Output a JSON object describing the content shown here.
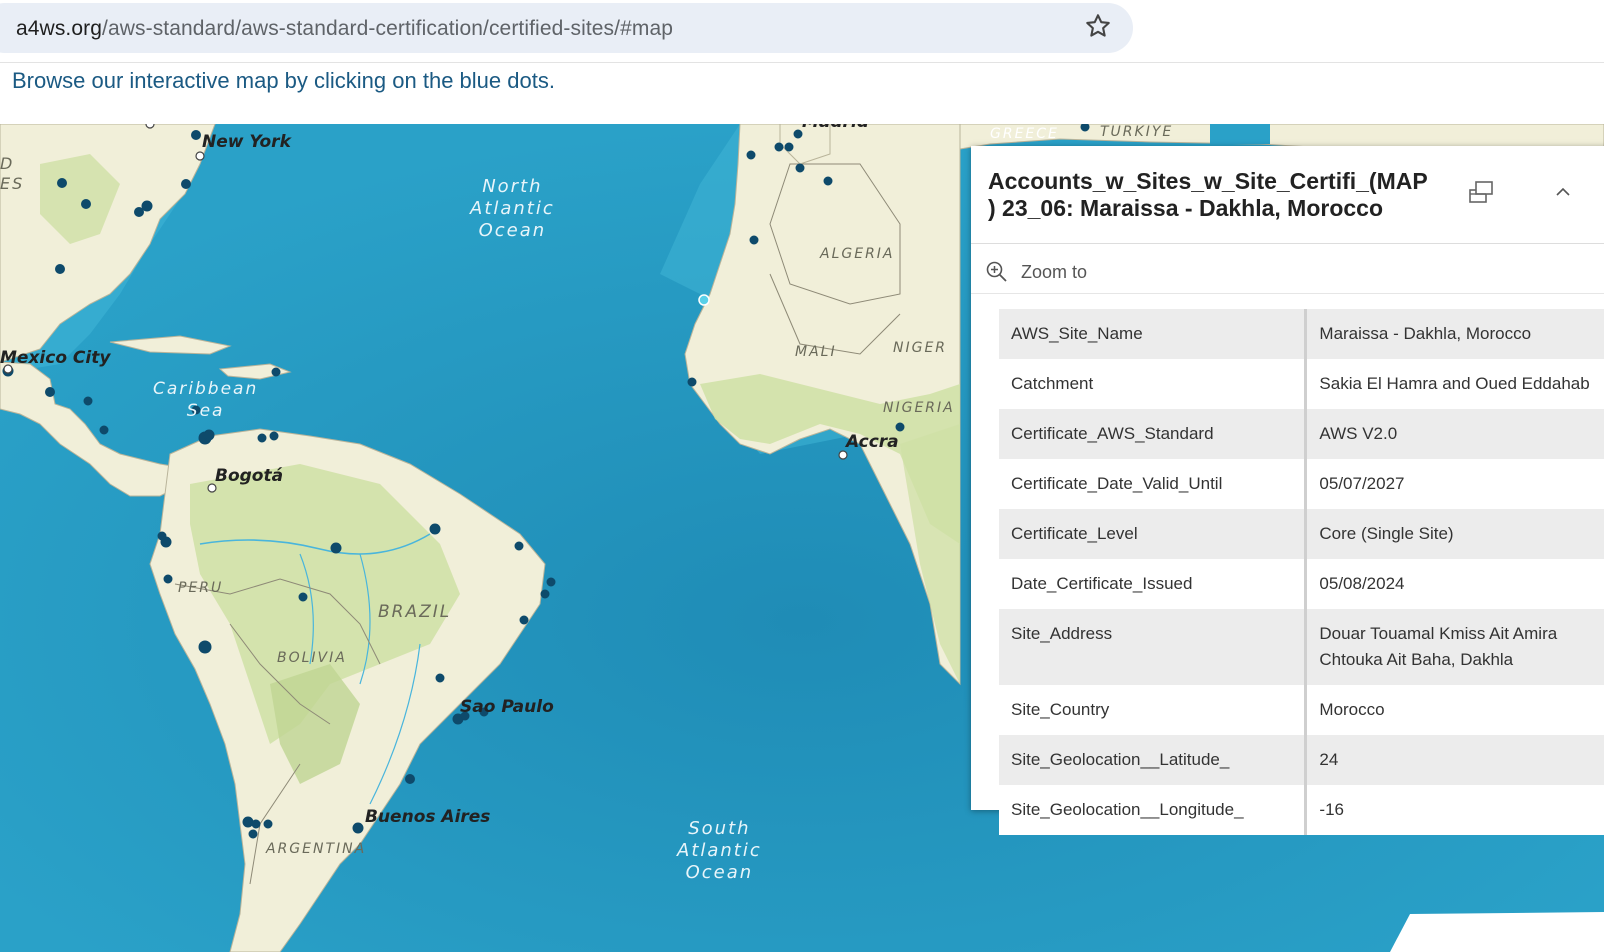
{
  "browser": {
    "url_domain": "a4ws.org",
    "url_path": "/aws-standard/aws-standard-certification/certified-sites/#map"
  },
  "intro_text": "Browse our interactive map by clicking on the blue dots.",
  "map": {
    "oceans": {
      "north_atlantic": [
        "North",
        "Atlantic",
        "Ocean"
      ],
      "south_atlantic": [
        "South",
        "Atlantic",
        "Ocean"
      ],
      "caribbean": [
        "Caribbean",
        "Sea"
      ]
    },
    "countries": [
      "ALGERIA",
      "MALI",
      "NIGER",
      "NIGERIA",
      "PERU",
      "BRAZIL",
      "BOLIVIA",
      "ARGENTINA",
      "GREECE",
      "TÜRKIYE"
    ],
    "cities": [
      "New York",
      "Mexico City",
      "Bogotá",
      "Sao Paulo",
      "Buenos Aires",
      "Accra",
      "Madrid"
    ],
    "edge_fragments": {
      "left_top": "D",
      "left_second": "ES"
    },
    "colors": {
      "ocean": "#2a9cc4",
      "land": "#f1efd9",
      "vegetation": "#cfe0a5",
      "dot": "#0e4a6b",
      "selected_dot": "#5ad0e8"
    }
  },
  "popup": {
    "title": "Accounts_w_Sites_w_Site_Certifi_(MAP ) 23_06: Maraissa - Dakhla, Morocco",
    "zoom_label": "Zoom to",
    "dock_icon": "dock-icon",
    "collapse_icon": "chevron-up-icon",
    "rows": [
      {
        "key": "AWS_Site_Name",
        "value": "Maraissa - Dakhla, Morocco"
      },
      {
        "key": "Catchment",
        "value": "Sakia El Hamra and Oued Eddahab"
      },
      {
        "key": "Certificate_AWS_Standard",
        "value": "AWS V2.0"
      },
      {
        "key": "Certificate_Date_Valid_Until",
        "value": "05/07/2027"
      },
      {
        "key": "Certificate_Level",
        "value": "Core (Single Site)"
      },
      {
        "key": "Date_Certificate_Issued",
        "value": "05/08/2024"
      },
      {
        "key": "Site_Address",
        "value": "Douar Touamal Kmiss Ait Amira Chtouka Ait Baha, Dakhla"
      },
      {
        "key": "Site_Country",
        "value": "Morocco"
      },
      {
        "key": "Site_Geolocation__Latitude_",
        "value": "24"
      },
      {
        "key": "Site_Geolocation__Longitude_",
        "value": "-16"
      }
    ]
  }
}
